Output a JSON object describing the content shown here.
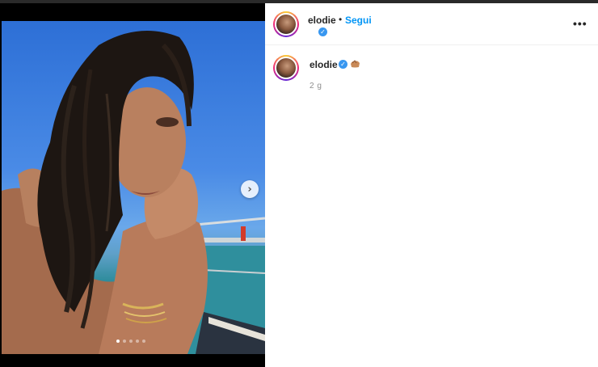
{
  "post": {
    "username": "elodie",
    "separator": "•",
    "follow_label": "Segui",
    "more_label": "•••",
    "verified_glyph": "✓",
    "time_ago": "2 g",
    "carousel": {
      "total_slides": 5,
      "active_slide": 1
    },
    "next_icon": "›"
  },
  "colors": {
    "follow_blue": "#0095f6",
    "verified_blue": "#3897f0",
    "text_primary": "#262626",
    "text_secondary": "#8e8e8e"
  },
  "icons": [
    "chevron-right-icon",
    "verified-badge-icon",
    "more-options-icon",
    "emoji-icon"
  ]
}
